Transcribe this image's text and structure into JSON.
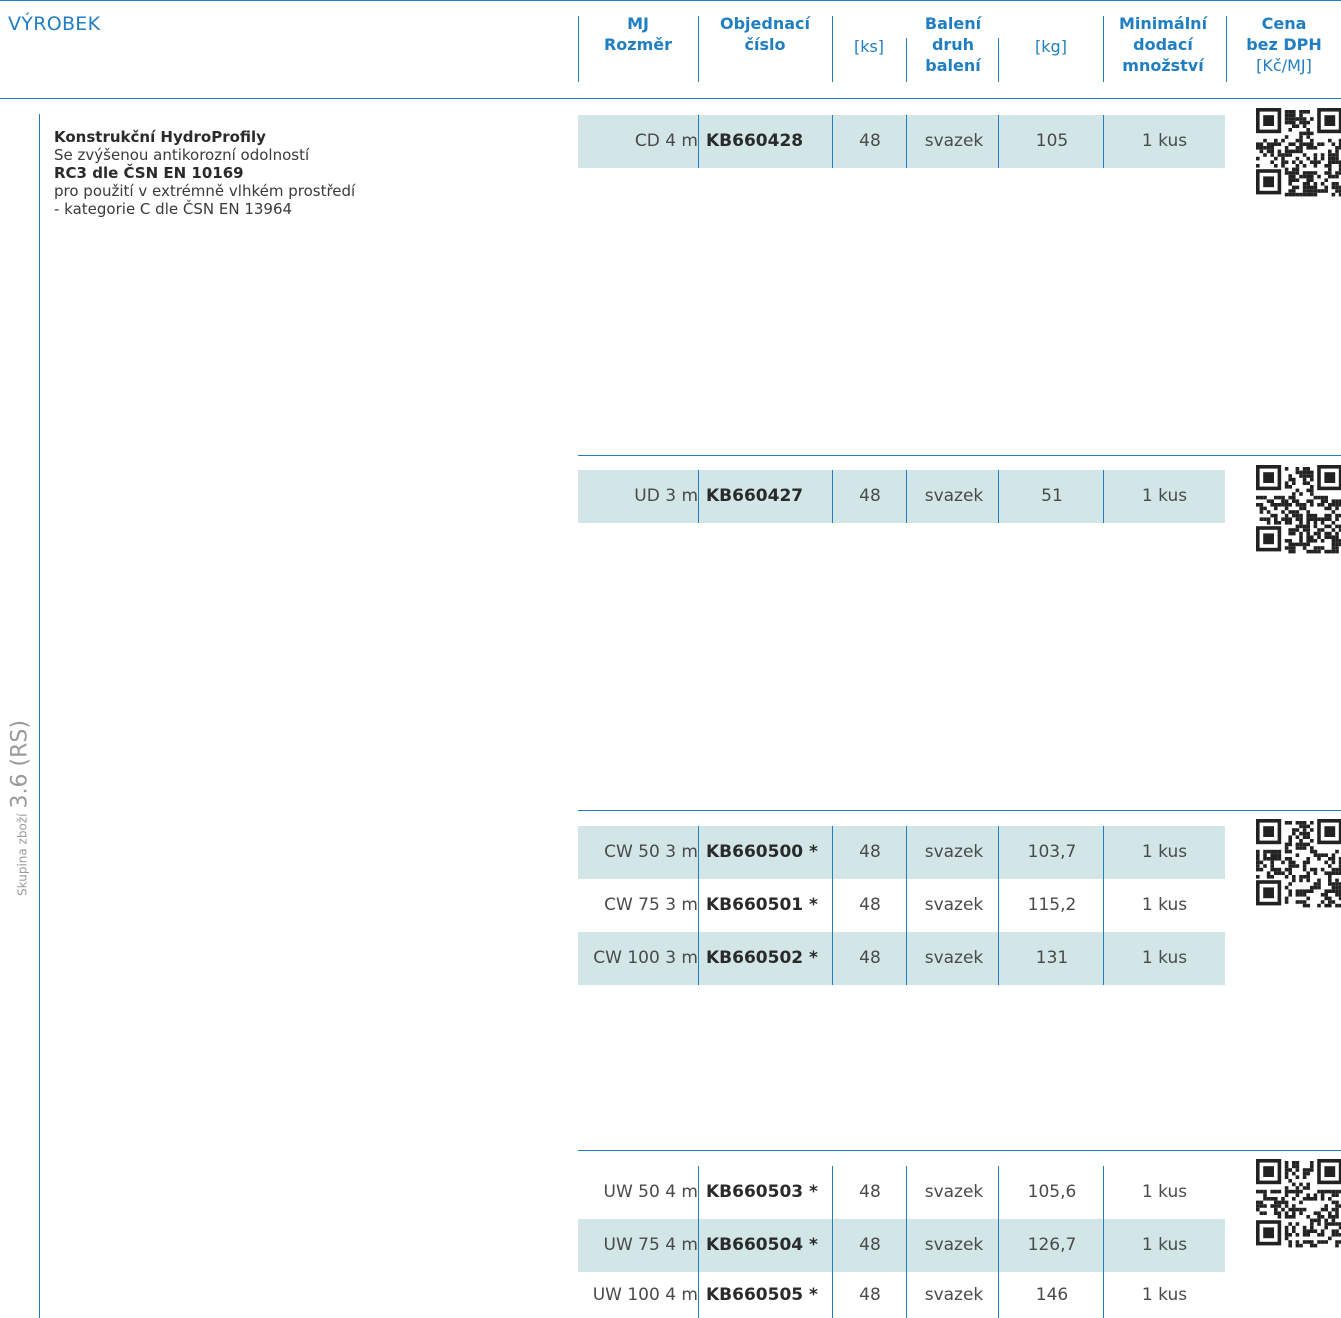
{
  "header": {
    "title": "VÝROBEK",
    "mj_line1": "MJ",
    "mj_line2": "Rozměr",
    "order_line1": "Objednací",
    "order_line2": "číslo",
    "pcs_unit": "[ks]",
    "packing_line1": "Balení",
    "packing_line2": "druh",
    "packing_line3": "balení",
    "weight_unit": "[kg]",
    "min_line1": "Minimální",
    "min_line2": "dodací",
    "min_line3": "množství",
    "price_line1": "Cena",
    "price_line2": "bez DPH",
    "price_unit": "[Kč/MJ]"
  },
  "side_label": {
    "small": "Skupina zboží",
    "large": "3.6 (RS)"
  },
  "description": {
    "line1": "Konstrukční HydroProfily",
    "line2": "Se zvýšenou antikorozní odolností",
    "line3": "RC3 dle ČSN EN 10169",
    "line4": "pro použití v extrémně vlhkém prostředí",
    "line5": "- kategorie C dle ČSN EN 13964"
  },
  "groups": [
    {
      "rows": [
        {
          "dim": "CD 4 m",
          "order": "KB660428",
          "pcs": "48",
          "packing": "svazek",
          "kg": "105",
          "min": "1 kus"
        }
      ]
    },
    {
      "rows": [
        {
          "dim": "UD 3 m",
          "order": "KB660427",
          "pcs": "48",
          "packing": "svazek",
          "kg": "51",
          "min": "1 kus"
        }
      ]
    },
    {
      "rows": [
        {
          "dim": "CW 50 3 m",
          "order": "KB660500 *",
          "pcs": "48",
          "packing": "svazek",
          "kg": "103,7",
          "min": "1 kus"
        },
        {
          "dim": "CW 75 3 m",
          "order": "KB660501 *",
          "pcs": "48",
          "packing": "svazek",
          "kg": "115,2",
          "min": "1 kus"
        },
        {
          "dim": "CW 100 3 m",
          "order": "KB660502 *",
          "pcs": "48",
          "packing": "svazek",
          "kg": "131",
          "min": "1 kus"
        }
      ]
    },
    {
      "rows": [
        {
          "dim": "UW 50 4 m",
          "order": "KB660503 *",
          "pcs": "48",
          "packing": "svazek",
          "kg": "105,6",
          "min": "1 kus"
        },
        {
          "dim": "UW 75 4 m",
          "order": "KB660504 *",
          "pcs": "48",
          "packing": "svazek",
          "kg": "126,7",
          "min": "1 kus"
        },
        {
          "dim": "UW 100 4 m",
          "order": "KB660505 *",
          "pcs": "48",
          "packing": "svazek",
          "kg": "146",
          "min": "1 kus"
        }
      ]
    }
  ],
  "colors": {
    "accent": "#1f7fc2",
    "row_shade": "#d3e6e7"
  }
}
